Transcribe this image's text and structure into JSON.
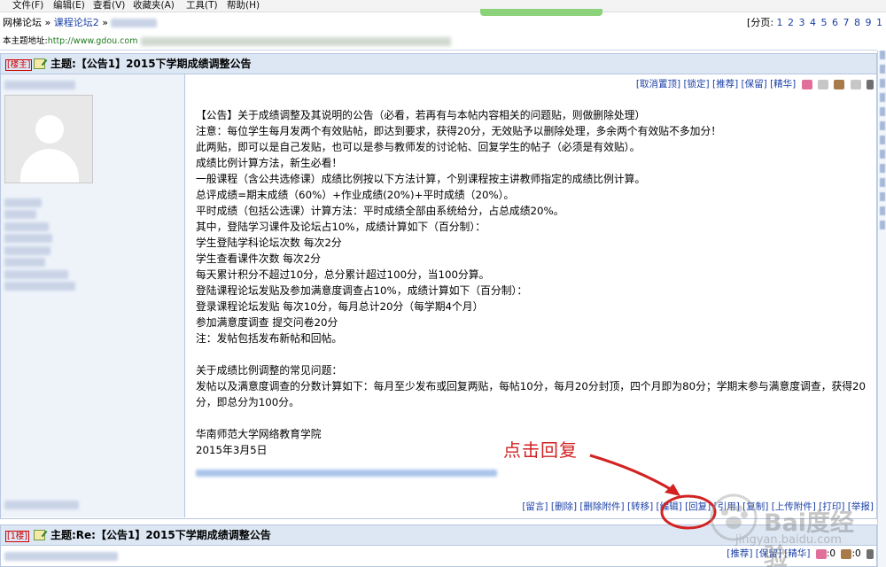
{
  "menu": [
    "文件(F)",
    "编辑(E)",
    "查看(V)",
    "收藏夹(A)",
    "工具(T)",
    "帮助(H)"
  ],
  "breadcrumb": {
    "site": "网梯论坛",
    "sep1": "»",
    "forum": "课程论坛2",
    "sep2": "»"
  },
  "pager": {
    "label": "[分页:",
    "pages": "1 2 3 4 5 6 7 8 9 1"
  },
  "address": {
    "label": "本主题地址:",
    "url": "http://www.gdou.com"
  },
  "post1": {
    "floor_label": "楼主",
    "title": "主题:【公告1】2015下学期成绩调整公告",
    "top_actions": [
      "[取消置顶]",
      "[锁定]",
      "[推荐]",
      "[保留]",
      "[精华]"
    ],
    "content_lines": [
      "【公告】关于成绩调整及其说明的公告（必看，若再有与本帖内容相关的问题贴，则做删除处理）",
      "注意：每位学生每月发两个有效贴帖，即达到要求，获得20分，无效贴予以删除处理，多余两个有效贴不多加分！",
      "此两贴，即可以是自己发贴，也可以是参与教师发的讨论帖、回复学生的帖子（必须是有效贴）。",
      "成绩比例计算方法，新生必看！",
      "一般课程（含公共选修课）成绩比例按以下方法计算，个别课程按主讲教师指定的成绩比例计算。",
      "总评成绩=期末成绩（60%）+作业成绩(20%)+平时成绩（20%）。",
      "平时成绩（包括公选课）计算方法：平时成绩全部由系统给分，占总成绩20%。",
      "其中，登陆学习课件及论坛占10%，成绩计算如下（百分制）：",
      "学生登陆学科论坛次数 每次2分",
      "学生查看课件次数 每次2分",
      "每天累计积分不超过10分，总分累计超过100分，当100分算。",
      "登陆课程论坛发贴及参加满意度调查占10%，成绩计算如下（百分制）：",
      "登录课程论坛发贴 每次10分，每月总计20分（每学期4个月）",
      "参加满意度调查 提交问卷20分",
      "注：发帖包括发布新帖和回帖。"
    ],
    "faq_title": "关于成绩比例调整的常见问题：",
    "faq_text": "发帖以及满意度调查的分数计算如下：每月至少发布或回复两贴，每帖10分，每月20分封顶，四个月即为80分；学期末参与满意度调查，获得20分，即总分为100分。",
    "org": "华南师范大学网络教育学院",
    "date": "2015年3月5日",
    "bottom_actions": [
      "[留言]",
      "[删除]",
      "[删除附件]",
      "[转移]",
      "[编辑]",
      "[回复]",
      "[引用]",
      "[复制]",
      "[上传附件]",
      "[打印]",
      "[举报]"
    ]
  },
  "annotation": {
    "text": "点击回复",
    "color": "#d22222"
  },
  "post2": {
    "floor_label": "1楼",
    "title": "主题:Re:【公告1】2015下学期成绩调整公告",
    "actions": [
      "[推荐]",
      "[保留]",
      "[精华]"
    ],
    "count1": ":0",
    "count2": ":0"
  },
  "watermark": {
    "big": "Bai度经验",
    "small": "jingyan.baidu.com"
  },
  "icons": [
    "edit-icon",
    "pink-flower-icon",
    "egg-icon",
    "phone-icon"
  ]
}
